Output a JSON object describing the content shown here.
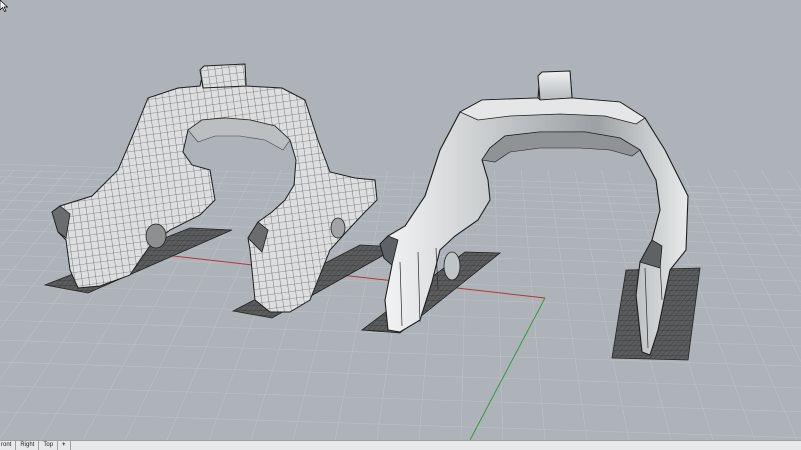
{
  "viewport": {
    "tabs": [
      {
        "label": "ront"
      },
      {
        "label": "Right"
      },
      {
        "label": "Top"
      }
    ],
    "add_tab_label": "+"
  },
  "colors": {
    "background": "#adb3b8",
    "grid": "#bcc2c6",
    "x_axis": "#b5372f",
    "y_axis": "#2f9e3c",
    "mesh_fill": "#d9dbdc",
    "mesh_line": "#3a3a3a",
    "surface_fill": "#cfd2d4"
  }
}
